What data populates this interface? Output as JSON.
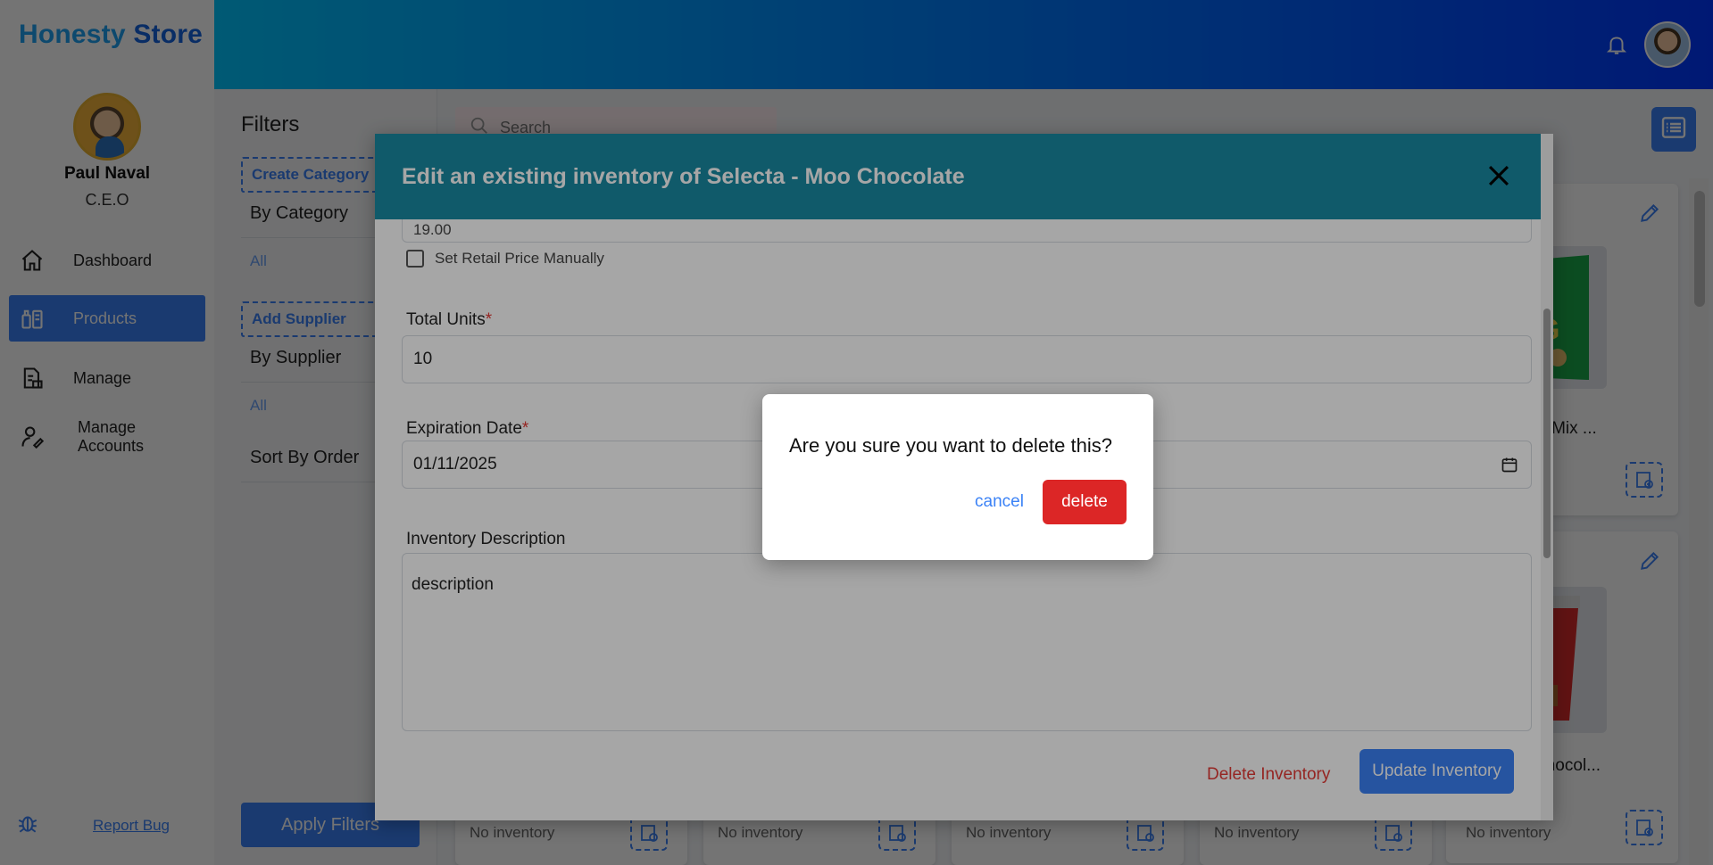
{
  "brand": {
    "part1": "Honesty",
    "part2": "Store"
  },
  "user": {
    "name": "Paul Naval",
    "role": "C.E.O"
  },
  "nav": [
    {
      "label": "Dashboard",
      "icon": "home-icon"
    },
    {
      "label": "Products",
      "icon": "products-icon",
      "active": true
    },
    {
      "label": "Manage",
      "icon": "manage-icon"
    },
    {
      "label": "Manage Accounts",
      "icon": "accounts-icon"
    }
  ],
  "report": {
    "label": "Report Bug",
    "icon": "bug-icon"
  },
  "filters": {
    "title": "Filters",
    "create_category": "Create Category",
    "by_category": "By Category",
    "category_all": "All",
    "add_supplier": "Add Supplier",
    "by_supplier": "By Supplier",
    "supplier_all": "All",
    "sort_by": "Sort By Order",
    "apply": "Apply Filters"
  },
  "search": {
    "placeholder": "Search"
  },
  "products": [
    {
      "name": "Snack Mix ..."
    },
    {
      "name": "an - Chocol..."
    }
  ],
  "inventory_empty": "No inventory",
  "modal": {
    "title": "Edit an existing inventory of Selecta - Moo Chocolate",
    "partial_value": "19.00",
    "set_retail_manual": "Set Retail Price Manually",
    "total_units_label": "Total Units",
    "total_units_value": "10",
    "expiration_label": "Expiration Date",
    "expiration_value": "01/11/2025",
    "description_label": "Inventory Description",
    "description_value": "description",
    "delete_btn": "Delete Inventory",
    "update_btn": "Update Inventory",
    "required_mark": "*"
  },
  "confirm": {
    "question": "Are you sure you want to delete this?",
    "cancel": "cancel",
    "delete": "delete"
  },
  "colors": {
    "primary": "#3b82f6",
    "header_start": "#00c6ff",
    "header_end": "#0037ff",
    "modal_header": "#1a8aa3",
    "danger": "#dc2626"
  }
}
